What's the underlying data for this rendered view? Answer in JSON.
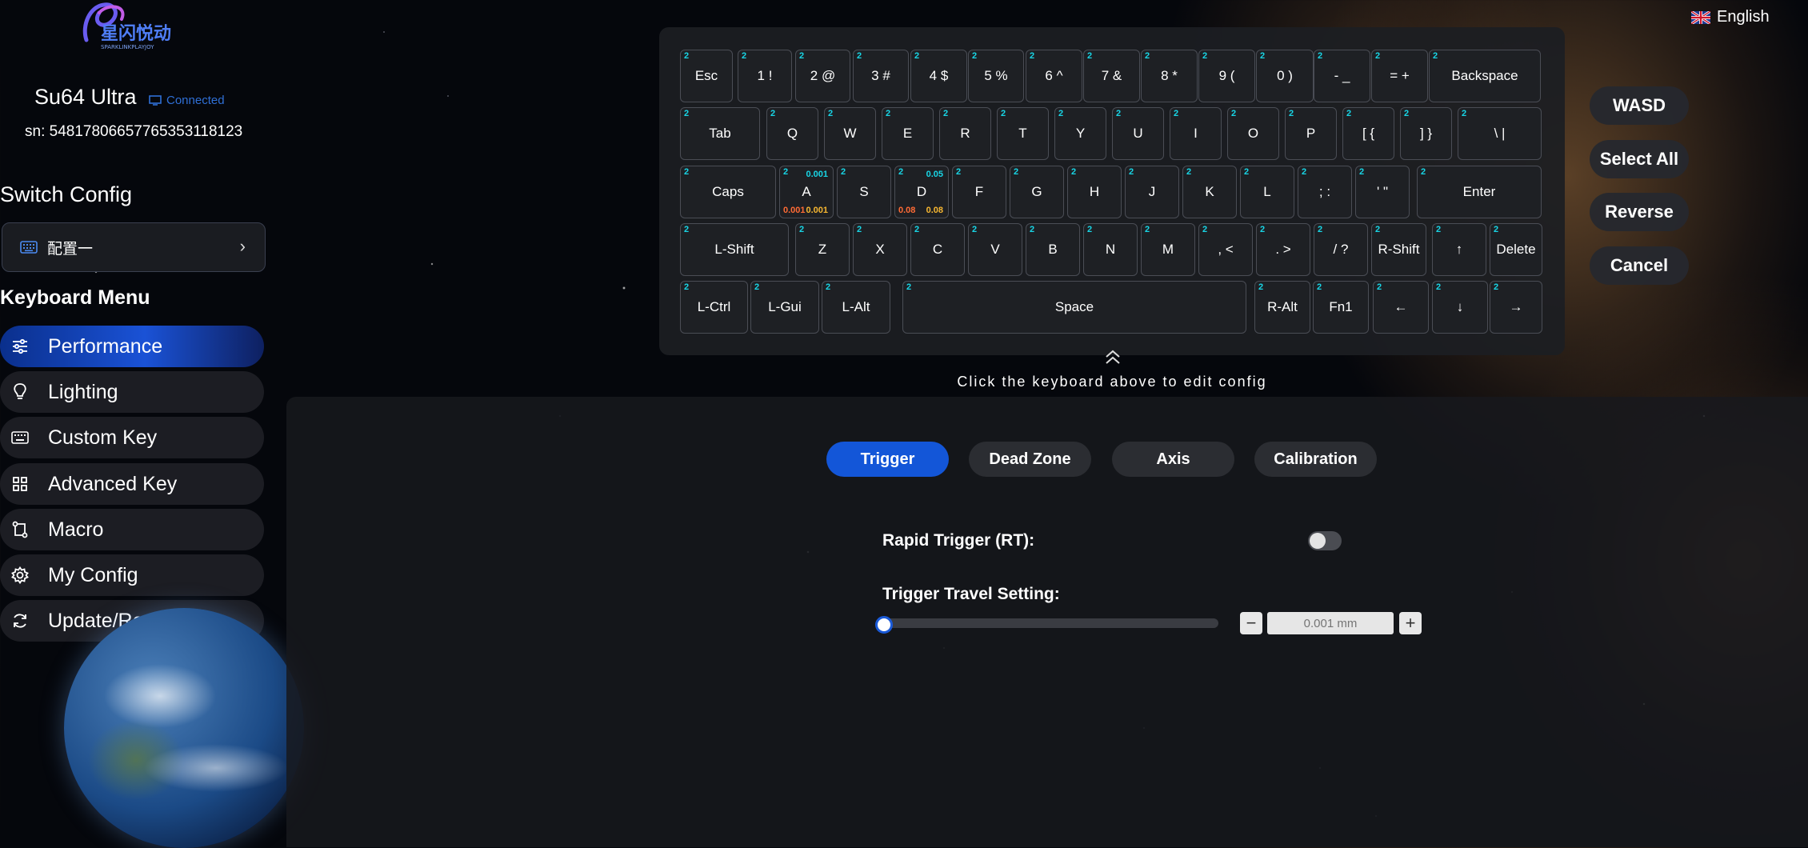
{
  "brand": {
    "logo_text": "星闪悦动",
    "logo_subtext": "SPARKLINKPLAYJOY"
  },
  "device": {
    "name": "Su64 Ultra",
    "status": "Connected",
    "serial": "sn: 5481780665776535311812​3"
  },
  "switch_config": {
    "title": "Switch Config",
    "current": "配置一"
  },
  "menu": {
    "title": "Keyboard Menu",
    "items": [
      {
        "label": "Performance",
        "icon": "sliders-icon"
      },
      {
        "label": "Lighting",
        "icon": "bulb-icon"
      },
      {
        "label": "Custom Key",
        "icon": "keyboard-icon"
      },
      {
        "label": "Advanced Key",
        "icon": "grid-icon"
      },
      {
        "label": "Macro",
        "icon": "macro-icon"
      },
      {
        "label": "My Config",
        "icon": "gear-icon"
      },
      {
        "label": "Update/Restore",
        "icon": "refresh-icon"
      }
    ]
  },
  "language": {
    "label": "English",
    "flag": "uk-flag-icon"
  },
  "keyboard": {
    "layer": "2",
    "rows": [
      [
        "Esc",
        "1 !",
        "2 @",
        "3 #",
        "4 $",
        "5 %",
        "6 ^",
        "7 &",
        "8 *",
        "9 (",
        "0 )",
        "- _",
        "= +",
        "Backspace"
      ],
      [
        "Tab",
        "Q",
        "W",
        "E",
        "R",
        "T",
        "Y",
        "U",
        "I",
        "O",
        "P",
        "[ {",
        "] }",
        "\\ |"
      ],
      [
        "Caps",
        "A",
        "S",
        "D",
        "F",
        "G",
        "H",
        "J",
        "K",
        "L",
        "; :",
        "' \"",
        "Enter"
      ],
      [
        "L-Shift",
        "Z",
        "X",
        "C",
        "V",
        "B",
        "N",
        "M",
        ", <",
        ". >",
        "/ ?",
        "R-Shift",
        "↑",
        "Delete"
      ],
      [
        "L-Ctrl",
        "L-Gui",
        "L-Alt",
        "Space",
        "R-Alt",
        "Fn1",
        "←",
        "↓",
        "→"
      ]
    ],
    "key_values": {
      "A": {
        "travel": "0.001",
        "press": "0.001",
        "release": "0.001"
      },
      "D": {
        "travel": "0.05",
        "press": "0.08",
        "release": "0.08"
      }
    },
    "hint": "Click the keyboard above to edit config"
  },
  "quick_select": [
    "WASD",
    "Select All",
    "Reverse",
    "Cancel"
  ],
  "tabs": [
    "Trigger",
    "Dead Zone",
    "Axis",
    "Calibration"
  ],
  "settings": {
    "rapid_trigger_label": "Rapid Trigger (RT):",
    "rapid_trigger_on": false,
    "trigger_travel_label": "Trigger Travel Setting:",
    "trigger_travel_fraction": 0,
    "trigger_travel_placeholder": "0.001 mm",
    "minus": "−",
    "plus": "+"
  },
  "colors": {
    "accent": "#1356d8",
    "layer_label": "#18d6e6",
    "press_value": "#ff6b35",
    "release_value": "#f7b731",
    "connected": "#2f6fd6"
  }
}
